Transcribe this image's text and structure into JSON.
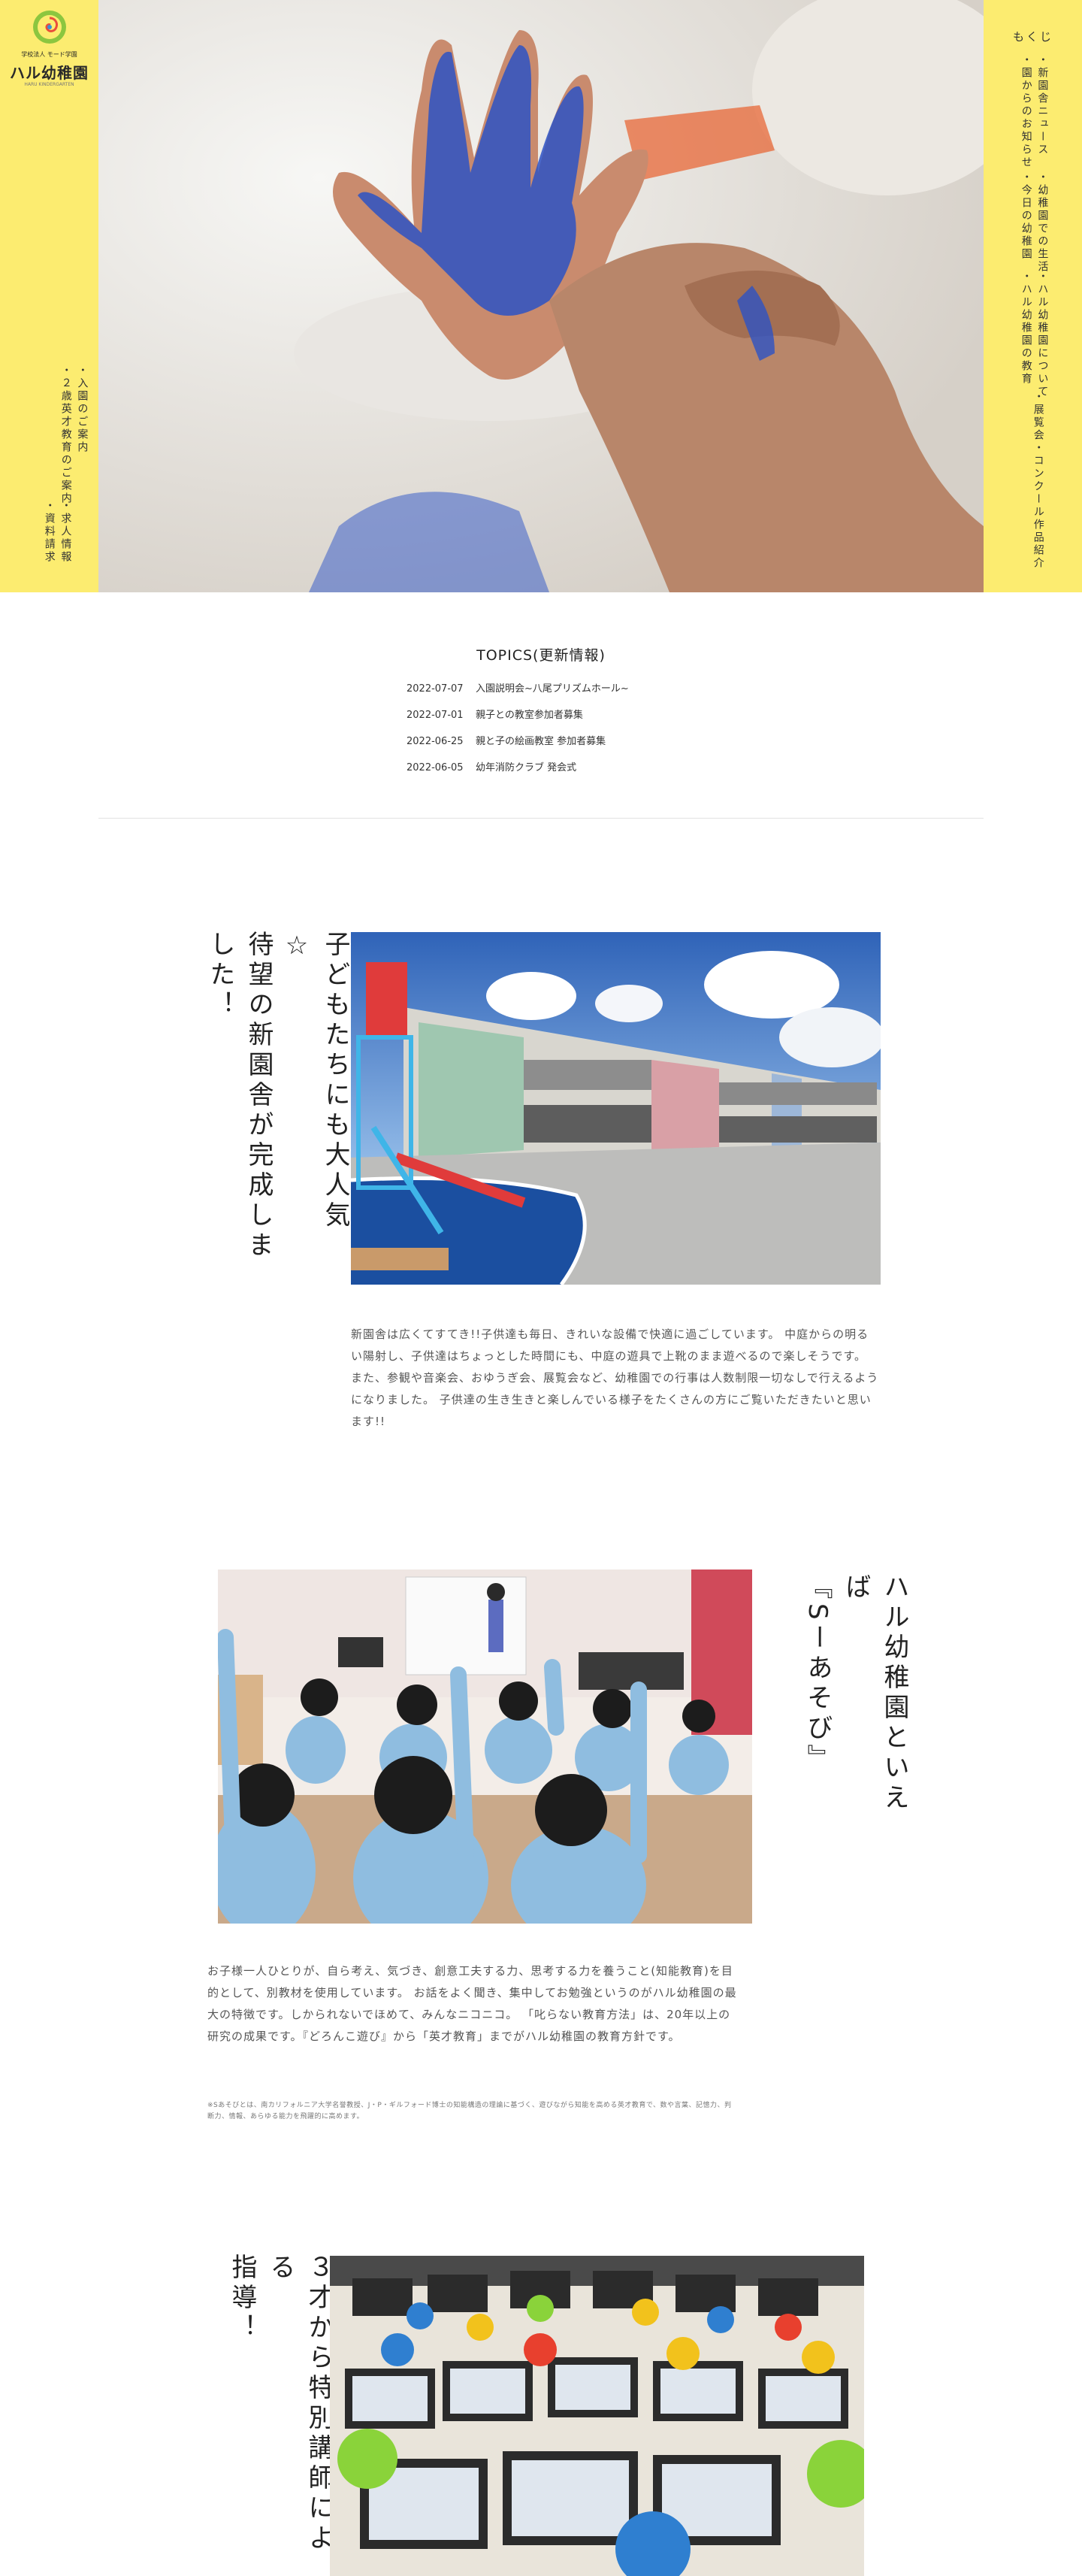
{
  "brand": {
    "org": "学校法人 モード学園",
    "name": "ハル幼稚園",
    "sub": "HARU KINDERGARTEN"
  },
  "left_nav": [
    {
      "label": "・入園のご案内"
    },
    {
      "label": "・２歳英才教育のご案内"
    },
    {
      "label": "・求人情報"
    },
    {
      "label": "・資料請求"
    }
  ],
  "toc": {
    "title": "もくじ",
    "items": [
      {
        "label": "・新園舎ニュース"
      },
      {
        "label": "・園からのお知らせ"
      },
      {
        "label": "・幼稚園での生活"
      },
      {
        "label": "・今日の幼稚園"
      },
      {
        "label": "・ハル幼稚園について"
      },
      {
        "label": "・ハル幼稚園の教育"
      },
      {
        "label": "・展覧会・コンクール作品紹介"
      }
    ]
  },
  "topics": {
    "title": "TOPICS(更新情報)",
    "items": [
      {
        "date": "2022-07-07",
        "text": "入園説明会~八尾プリズムホール~"
      },
      {
        "date": "2022-07-01",
        "text": "親子との教室参加者募集"
      },
      {
        "date": "2022-06-25",
        "text": "親と子の絵画教室 参加者募集"
      },
      {
        "date": "2022-06-05",
        "text": "幼年消防クラブ 発会式"
      }
    ]
  },
  "section1": {
    "heading_lines": [
      "した！",
      "待望の新園舎が完成しま",
      "子どもたちにも大人気☆"
    ],
    "paragraph": "新園舎は広くてすてき!!子供達も毎日、きれいな設備で快適に過ごしています。 中庭からの明るい陽射し、子供達はちょっとした時間にも、中庭の遊具で上靴のまま遊べるので楽しそうです。 また、参観や音楽会、おゆうぎ会、展覧会など、幼稚園での行事は人数制限一切なしで行えるようになりました。 子供達の生き生きと楽しんでいる様子をたくさんの方にご覧いただきたいと思います!!"
  },
  "section2": {
    "heading_lines": [
      "ハル幼稚園といえば",
      "『Sーあそび』"
    ],
    "paragraph": "お子様一人ひとりが、自ら考え、気づき、創意工夫する力、思考する力を養うこと(知能教育)を目的として、別教材を使用しています。 お話をよく聞き、集中してお勉強というのがハル幼稚園の最大の特徴です。しかられないでほめて、みんなニコニコ。 「叱らない教育方法」は、20年以上の研究の成果です。『どろんこ遊び』から「英才教育」までがハル幼稚園の教育方針です。",
    "note": "※Sあそびとは、南カリフォルニア大学名誉教授、J・P・ギルフォード博士の知能構造の理論に基づく、遊びながら知能を高める英才教育で、数や言葉、記憶力、判断力、情報、あらゆる能力を飛躍的に高めます。"
  },
  "section3": {
    "heading_lines": [
      "指導！",
      "３才から特別講師による"
    ]
  },
  "colors": {
    "accent": "#fcec70"
  }
}
